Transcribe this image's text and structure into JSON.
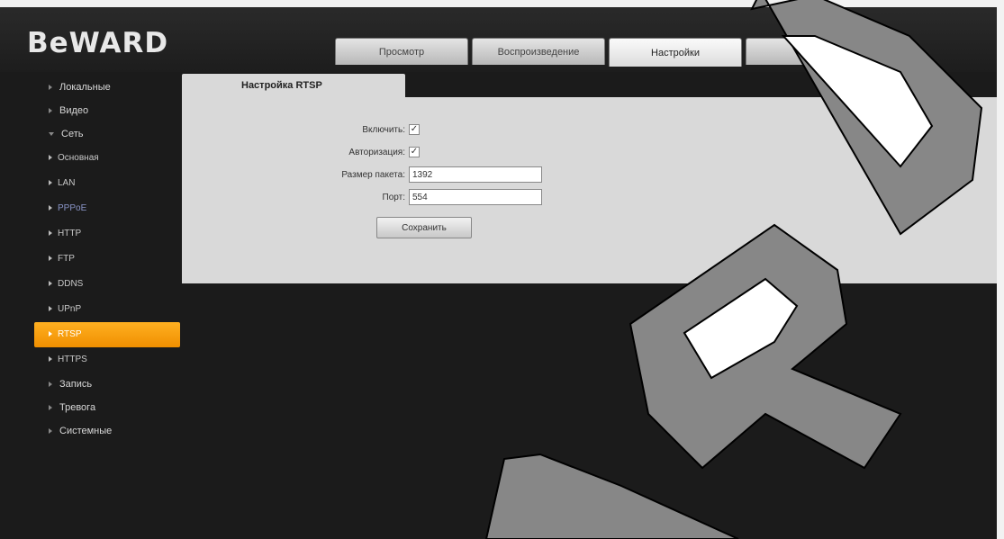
{
  "brand": {
    "logo_text": "BeWARD"
  },
  "top_tabs": [
    {
      "label": "Просмотр",
      "active": false
    },
    {
      "label": "Воспроизведение",
      "active": false
    },
    {
      "label": "Настройки",
      "active": true
    },
    {
      "label": "",
      "active": false
    },
    {
      "label": "",
      "active": false
    }
  ],
  "sidebar": {
    "items": [
      {
        "label": "Локальные",
        "level": 0,
        "state": "closed"
      },
      {
        "label": "Видео",
        "level": 0,
        "state": "closed"
      },
      {
        "label": "Сеть",
        "level": 0,
        "state": "open"
      },
      {
        "label": "Основная",
        "level": 1
      },
      {
        "label": "LAN",
        "level": 1
      },
      {
        "label": "PPPoE",
        "level": 1
      },
      {
        "label": "HTTP",
        "level": 1
      },
      {
        "label": "FTP",
        "level": 1
      },
      {
        "label": "DDNS",
        "level": 1
      },
      {
        "label": "UPnP",
        "level": 1
      },
      {
        "label": "RTSP",
        "level": 1,
        "active": true
      },
      {
        "label": "HTTPS",
        "level": 1
      },
      {
        "label": "Запись",
        "level": 0,
        "state": "closed"
      },
      {
        "label": "Тревога",
        "level": 0,
        "state": "closed"
      },
      {
        "label": "Системные",
        "level": 0,
        "state": "closed"
      }
    ]
  },
  "panel": {
    "tab_label": "Настройка RTSP",
    "fields": {
      "enable_label": "Включить:",
      "enable_checked": "✓",
      "auth_label": "Авторизация:",
      "auth_checked": "✓",
      "packet_size_label": "Размер пакета:",
      "packet_size_value": "1392",
      "port_label": "Порт:",
      "port_value": "554"
    },
    "save_button": "Сохранить"
  },
  "colors": {
    "accent": "#f5a000",
    "panel_bg": "#d9d9d9",
    "app_bg": "#1b1b1b",
    "watermark": "#878787"
  },
  "watermark_text": "ARD"
}
